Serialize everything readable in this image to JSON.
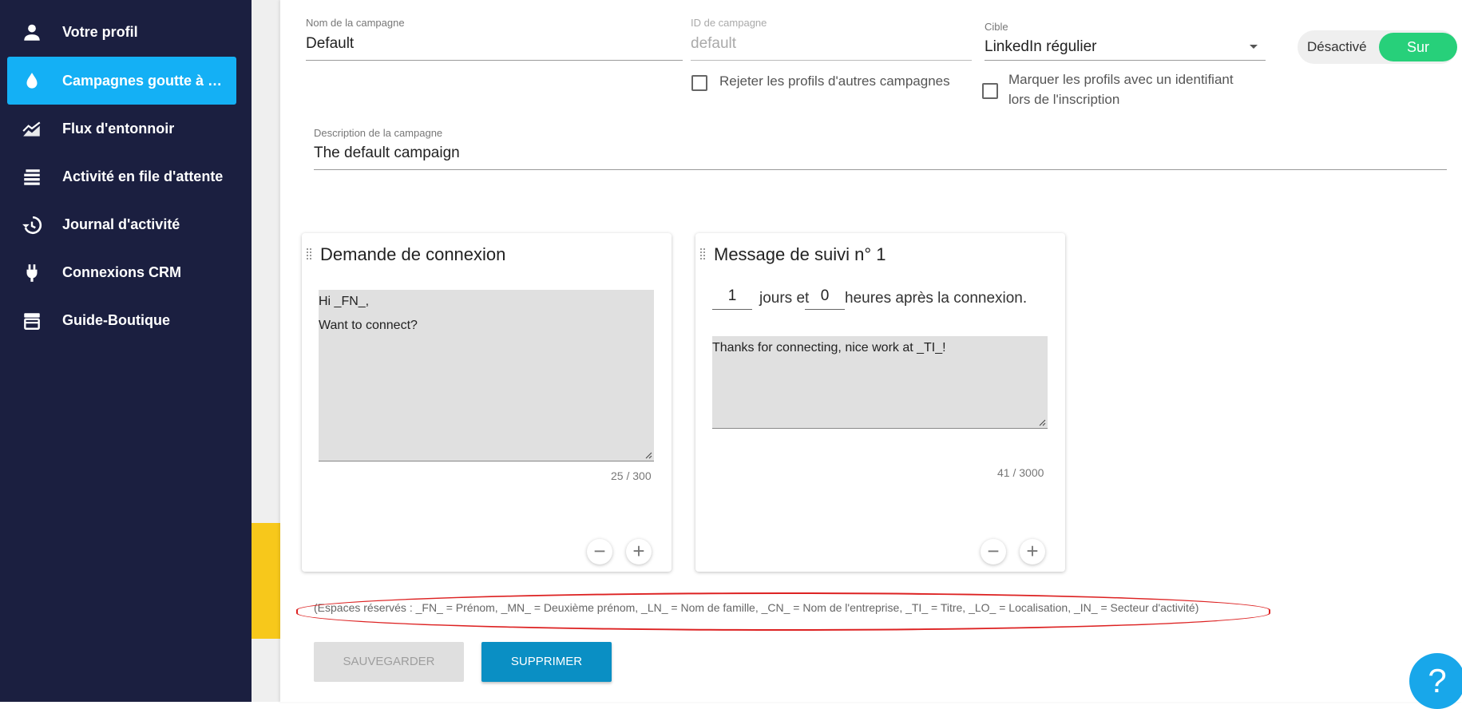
{
  "sidebar": {
    "items": [
      {
        "label": "Votre profil",
        "icon": "person-icon",
        "active": false
      },
      {
        "label": "Campagnes goutte à g…",
        "icon": "drop-icon",
        "active": true
      },
      {
        "label": "Flux d'entonnoir",
        "icon": "area-chart-icon",
        "active": false
      },
      {
        "label": "Activité en file d'attente",
        "icon": "queue-icon",
        "active": false
      },
      {
        "label": "Journal d'activité",
        "icon": "history-icon",
        "active": false
      },
      {
        "label": "Connexions CRM",
        "icon": "plug-icon",
        "active": false
      },
      {
        "label": "Guide-Boutique",
        "icon": "store-icon",
        "active": false
      }
    ]
  },
  "form": {
    "name": {
      "label": "Nom de la campagne",
      "value": "Default"
    },
    "id": {
      "label": "ID de campagne",
      "value": "default"
    },
    "target": {
      "label": "Cible",
      "value": "LinkedIn régulier"
    },
    "reject_checkbox": {
      "label": "Rejeter les profils d'autres campagnes",
      "checked": false
    },
    "mark_checkbox": {
      "label_line1": "Marquer les profils avec un identifiant",
      "label_line2": "lors de l'inscription",
      "checked": false
    },
    "toggle": {
      "off_label": "Désactivé",
      "on_label": "Sur",
      "state": "on"
    },
    "description": {
      "label": "Description de la campagne",
      "value": "The default campaign"
    }
  },
  "cards": {
    "connection": {
      "title": "Demande de connexion",
      "message_line1": "Hi _FN_,",
      "message_line2": "Want to connect?",
      "counter": "25 / 300"
    },
    "followup": {
      "title": "Message de suivi n° 1",
      "days": "1",
      "days_label": "jours et",
      "hours": "0",
      "hours_label": "heures après la connexion.",
      "message": "Thanks for connecting, nice work at _TI_!",
      "counter": "41 / 3000"
    }
  },
  "placeholders_note": "(Espaces réservés : _FN_ = Prénom, _MN_ = Deuxième prénom, _LN_ = Nom de famille, _CN_ = Nom de l'entreprise, _TI_ = Titre, _LO_ = Localisation, _IN_ = Secteur d'activité)",
  "buttons": {
    "save": "SAUVEGARDER",
    "delete": "SUPPRIMER",
    "help": "?"
  },
  "colors": {
    "sidebar": "#1b1f40",
    "active": "#14b0f5",
    "toggle_on": "#27d07a",
    "delete": "#0a8fc4",
    "highlight": "#dd2222"
  }
}
